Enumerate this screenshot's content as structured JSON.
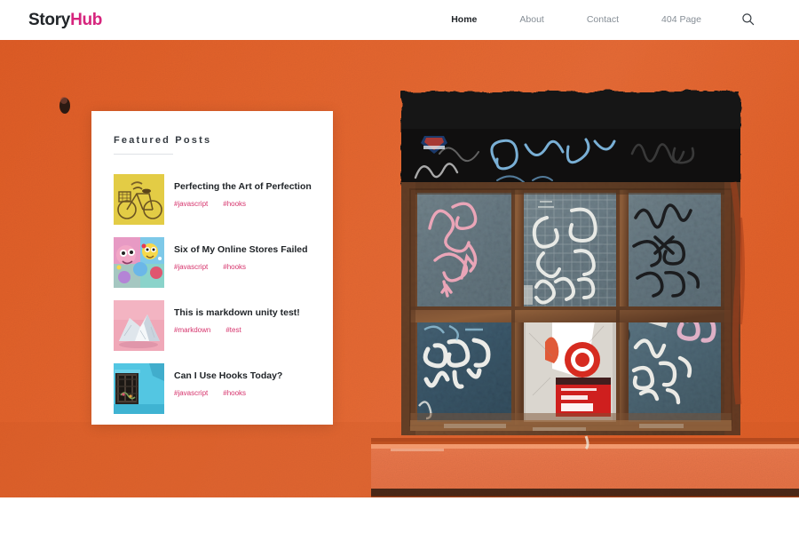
{
  "header": {
    "logo": {
      "part1": "Story",
      "part2": "Hub",
      "color1": "#212529",
      "color2": "#d6247d"
    },
    "nav": [
      {
        "label": "Home",
        "active": true
      },
      {
        "label": "About",
        "active": false
      },
      {
        "label": "Contact",
        "active": false
      },
      {
        "label": "404 Page",
        "active": false
      }
    ],
    "search_icon": "search-icon"
  },
  "hero": {
    "description": "Orange stucco wall with graffiti-covered window, black lintel and rusty wooden frame",
    "wall_color": "#e2622d",
    "lintel_color": "#141414",
    "frame_color": "#6b4a33",
    "ledge_color": "#e07a4e"
  },
  "featured": {
    "title": "Featured Posts",
    "posts": [
      {
        "title": "Perfecting the Art of Perfection",
        "tags": [
          "#javascript",
          "#hooks"
        ],
        "thumb": "yellow-bicycle-thumb"
      },
      {
        "title": "Six of My Online Stores Failed",
        "tags": [
          "#javascript",
          "#hooks"
        ],
        "thumb": "colorful-graffiti-thumb"
      },
      {
        "title": "This is markdown unity test!",
        "tags": [
          "#markdown",
          "#test"
        ],
        "thumb": "pink-white-rock-thumb"
      },
      {
        "title": "Can I Use Hooks Today?",
        "tags": [
          "#javascript",
          "#hooks"
        ],
        "thumb": "cyan-wall-window-thumb"
      }
    ],
    "tag_color": "#d6336c"
  }
}
